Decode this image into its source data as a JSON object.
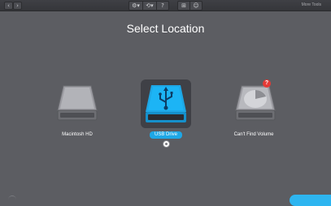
{
  "toolbar": {
    "back": "‹",
    "forward": "›",
    "tools": [
      "⚙▾",
      "⟲▾",
      "?"
    ],
    "view_tools": [
      "⊞",
      "☺"
    ],
    "more_tools": "More Tools"
  },
  "title": "Select Location",
  "drives": [
    {
      "label": "Macintosh HD",
      "icon": "hard-drive-icon",
      "selected": false
    },
    {
      "label": "USB Drive",
      "icon": "usb-drive-icon",
      "selected": true
    },
    {
      "label": "Can't Find Volume",
      "icon": "unknown-volume-icon",
      "selected": false,
      "badge": "?"
    }
  ],
  "colors": {
    "background": "#5c5d62",
    "accent": "#1ea7e6",
    "badge": "#e53935"
  }
}
